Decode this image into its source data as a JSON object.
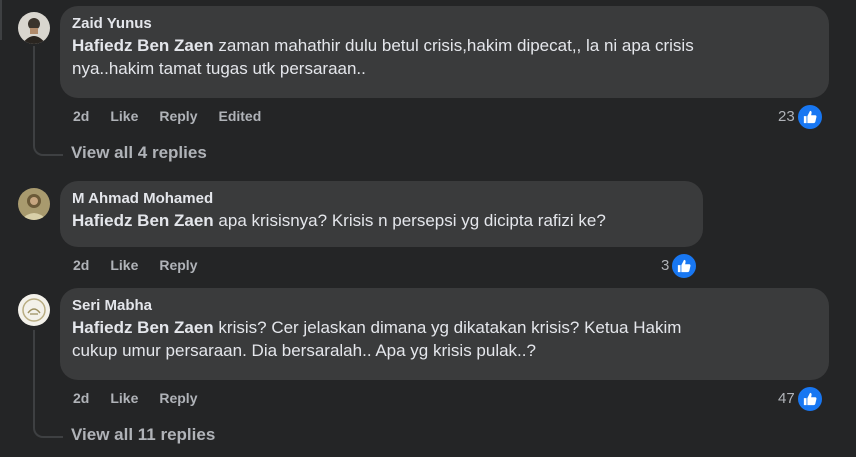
{
  "comments": [
    {
      "author": "Zaid Yunus",
      "mention": "Hafiedz Ben Zaen",
      "text_line1": " zaman mahathir dulu betul crisis,hakim dipecat,, la ni apa crisis",
      "text_line2": "nya..hakim tamat tugas utk persaraan..",
      "time": "2d",
      "like_label": "Like",
      "reply_label": "Reply",
      "edited_label": "Edited",
      "reaction_count": "23"
    },
    {
      "author": "M Ahmad Mohamed",
      "mention": "Hafiedz Ben Zaen",
      "text_line1": " apa krisisnya? Krisis n persepsi yg dicipta rafizi ke?",
      "time": "2d",
      "like_label": "Like",
      "reply_label": "Reply",
      "reaction_count": "3"
    },
    {
      "author": "Seri Mabha",
      "mention": "Hafiedz Ben Zaen",
      "text_line1": " krisis? Cer jelaskan dimana yg dikatakan krisis? Ketua Hakim",
      "text_line2": "cukup umur persaraan. Dia bersaralah.. Apa yg krisis pulak..?",
      "time": "2d",
      "like_label": "Like",
      "reply_label": "Reply",
      "reaction_count": "47"
    }
  ],
  "view_replies": [
    "View all 4 replies",
    "View all 11 replies"
  ],
  "colors": {
    "background": "#242526",
    "bubble": "#3a3b3c",
    "text": "#e4e6eb",
    "secondary": "#b0b3b8",
    "like_blue": "#1877f2"
  },
  "icons": {
    "reaction": "like-thumb-icon"
  }
}
